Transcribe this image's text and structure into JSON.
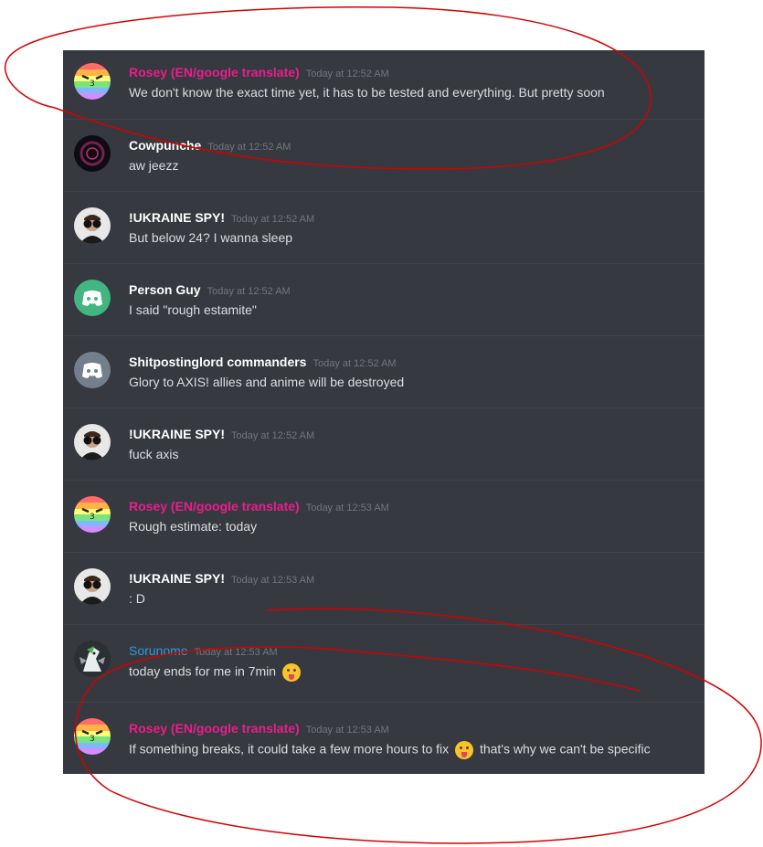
{
  "colors": {
    "pink_name": "#e91e8c",
    "white_name": "#ffffff",
    "blue_name": "#3498db",
    "timestamp": "#72767d",
    "text": "#dcddde",
    "background": "#36393f",
    "annotation": "#d40000"
  },
  "messages": [
    {
      "author": "Rosey (EN/google translate)",
      "time": "Today at 12:52 AM",
      "text": "We don't know the exact time yet, it has to be tested and everything. But pretty soon",
      "avatar_icon": "rainbow-face-avatar"
    },
    {
      "author": "Cowpunche",
      "time": "Today at 12:52 AM",
      "text": "aw jeezz",
      "avatar_icon": "dark-vortex-avatar"
    },
    {
      "author": "!UKRAINE SPY!",
      "time": "Today at 12:52 AM",
      "text": "But below 24? I wanna sleep",
      "avatar_icon": "binoculars-man-avatar"
    },
    {
      "author": "Person Guy",
      "time": "Today at 12:52 AM",
      "text": "I said \"rough estamite\"",
      "avatar_icon": "discord-green-avatar"
    },
    {
      "author": "Shitpostinglord commanders",
      "time": "Today at 12:52 AM",
      "text": "Glory to AXIS! allies and anime will be destroyed",
      "avatar_icon": "discord-grey-avatar"
    },
    {
      "author": "!UKRAINE SPY!",
      "time": "Today at 12:52 AM",
      "text": "fuck axis",
      "avatar_icon": "binoculars-man-avatar"
    },
    {
      "author": "Rosey (EN/google translate)",
      "time": "Today at 12:53 AM",
      "text": "Rough estimate: today",
      "avatar_icon": "rainbow-face-avatar"
    },
    {
      "author": "!UKRAINE SPY!",
      "time": "Today at 12:53 AM",
      "text": ": D",
      "avatar_icon": "binoculars-man-avatar"
    },
    {
      "author": "Sorunome",
      "time": "Today at 12:53 AM",
      "text": "today ends for me in 7min",
      "text_after": "",
      "avatar_icon": "pony-avatar"
    },
    {
      "author": "Rosey (EN/google translate)",
      "time": "Today at 12:53 AM",
      "text": "If something breaks, it could take a few more hours to fix",
      "text_after": "that's why we can't be specific",
      "avatar_icon": "rainbow-face-avatar"
    }
  ]
}
